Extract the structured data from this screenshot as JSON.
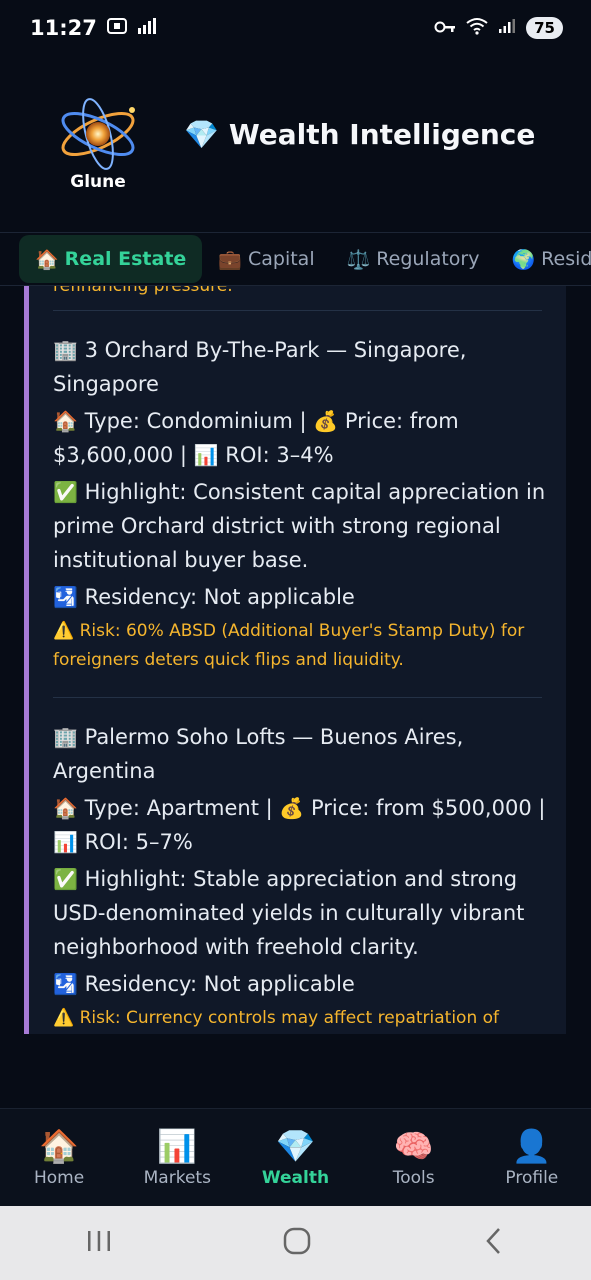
{
  "status_bar": {
    "time": "11:27",
    "battery": "75"
  },
  "header": {
    "logo_text": "Glune",
    "title_icon": "💎",
    "title": "Wealth Intelligence"
  },
  "tabs": [
    {
      "icon": "🏠",
      "label": "Real Estate",
      "active": true
    },
    {
      "icon": "💼",
      "label": "Capital",
      "active": false
    },
    {
      "icon": "⚖️",
      "label": "Regulatory",
      "active": false
    },
    {
      "icon": "🌍",
      "label": "Residency",
      "active": false
    }
  ],
  "content": {
    "cut_top_text": "refinancing pressure.",
    "listings": [
      {
        "title_icon": "🏢",
        "title": "3 Orchard By-The-Park — Singapore, Singapore",
        "type_icon": "🏠",
        "type_line": "Type: Condominium |",
        "price_icon": "💰",
        "price_line": "Price: from $3,600,000 |",
        "roi_icon": "📊",
        "roi_line": "ROI: 3–4%",
        "highlight_icon": "✅",
        "highlight": "Highlight: Consistent capital appreciation in prime Orchard district with strong regional institutional buyer base.",
        "residency_icon": "🛂",
        "residency": "Residency: Not applicable",
        "risk_icon": "⚠️",
        "risk": "Risk: 60% ABSD (Additional Buyer's Stamp Duty) for foreigners deters quick flips and liquidity."
      },
      {
        "title_icon": "🏢",
        "title": "Palermo Soho Lofts — Buenos Aires, Argentina",
        "type_icon": "🏠",
        "type_line": "Type: Apartment |",
        "price_icon": "💰",
        "price_line": "Price: from $500,000 |",
        "roi_icon": "📊",
        "roi_line": "ROI: 5–7%",
        "highlight_icon": "✅",
        "highlight": "Highlight: Stable appreciation and strong USD-denominated yields in culturally vibrant neighborhood with freehold clarity.",
        "residency_icon": "🛂",
        "residency": "Residency: Not applicable",
        "risk_icon": "⚠️",
        "risk": "Risk: Currency controls may affect repatriation of"
      }
    ]
  },
  "bottom_nav": [
    {
      "icon": "🏠",
      "label": "Home",
      "active": false
    },
    {
      "icon": "📊",
      "label": "Markets",
      "active": false
    },
    {
      "icon": "💎",
      "label": "Wealth",
      "active": true
    },
    {
      "icon": "🧠",
      "label": "Tools",
      "active": false
    },
    {
      "icon": "👤",
      "label": "Profile",
      "active": false
    }
  ],
  "colors": {
    "accent_green": "#34d399",
    "risk_amber": "#f5b52e",
    "card_border": "#a77bd6",
    "background": "#070c16"
  }
}
